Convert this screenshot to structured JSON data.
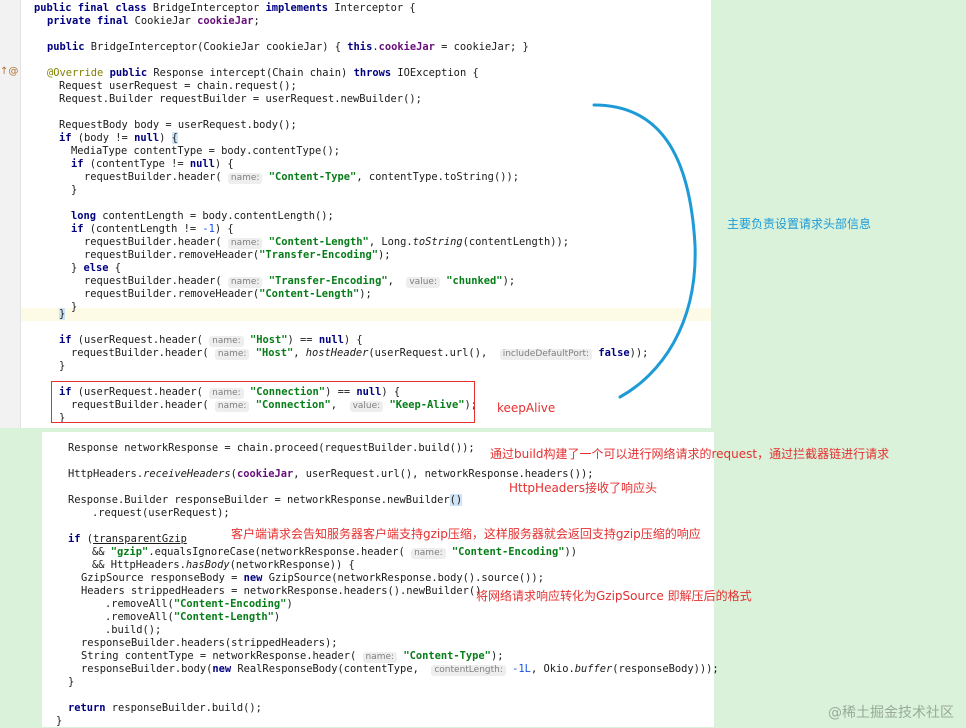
{
  "annotations": {
    "request_headers": "主要负责设置请求头部信息",
    "keep_alive": "keepAlive",
    "build_request": "通过build构建了一个可以进行网络请求的request，通过拦截器链进行请求",
    "http_headers": "HttpHeaders接收了响应头",
    "gzip_support": "客户端请求会告知服务器客户端支持gzip压缩，这样服务器就会返回支持gzip压缩的响应",
    "gzip_source": "将网络请求响应转化为GzipSource 即解压后的格式"
  },
  "watermark": "@稀土掘金技术社区",
  "hints": {
    "name": "name:",
    "value": "value:",
    "include_default_port": "includeDefaultPort:",
    "content_length": "contentLength:"
  },
  "strings": {
    "content_type": "\"Content-Type\"",
    "content_length": "\"Content-Length\"",
    "transfer_encoding": "\"Transfer-Encoding\"",
    "chunked": "\"chunked\"",
    "host": "\"Host\"",
    "connection": "\"Connection\"",
    "keep_alive": "\"Keep-Alive\"",
    "gzip": "\"gzip\"",
    "content_encoding": "\"Content-Encoding\""
  },
  "colors": {
    "background": "#d9f2d9",
    "annotation_red": "#e53030",
    "annotation_blue": "#1e9bd7"
  }
}
